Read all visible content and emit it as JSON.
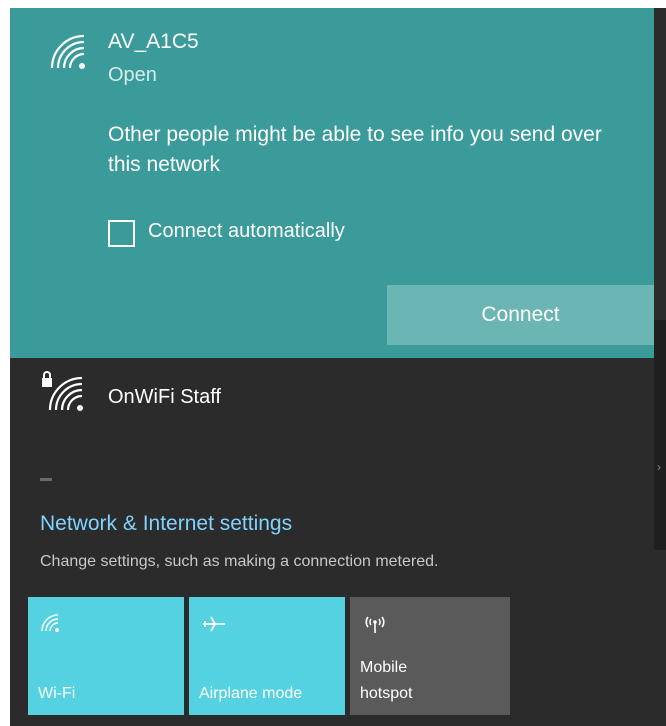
{
  "selected_network": {
    "name": "AV_A1C5",
    "status": "Open",
    "warning": "Other people might be able to see info you send over this network",
    "auto_connect_label": "Connect automatically",
    "auto_connect_checked": false,
    "connect_label": "Connect"
  },
  "networks": [
    {
      "name": "OnWiFi Staff",
      "secured": true
    }
  ],
  "settings": {
    "link": "Network & Internet settings",
    "description": "Change settings, such as making a connection metered."
  },
  "quick_actions": [
    {
      "label": "Wi-Fi",
      "icon": "wifi-icon",
      "active": true
    },
    {
      "label": "Airplane mode",
      "icon": "airplane-icon",
      "active": true
    },
    {
      "label_line1": "Mobile",
      "label_line2": "hotspot",
      "icon": "hotspot-icon",
      "active": false
    }
  ],
  "colors": {
    "accent_selected": "#3b9b9b",
    "tile_active": "#55d2e2",
    "tile_inactive": "#5a5a5a",
    "link": "#7fd3ff",
    "background": "#2b2b2b"
  }
}
